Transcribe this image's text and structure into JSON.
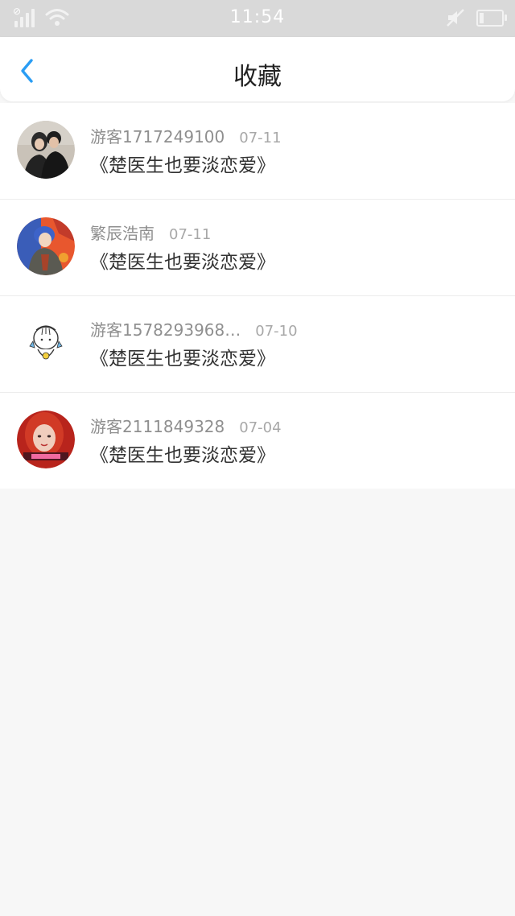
{
  "status_bar": {
    "time": "11:54"
  },
  "header": {
    "title": "收藏",
    "back_icon": "chevron-left-icon",
    "accent_color": "#2a9df4"
  },
  "favorites": [
    {
      "user": "游客1717249100",
      "date": "07-11",
      "book": "《楚医生也要淡恋爱》",
      "avatar": "couple-photo"
    },
    {
      "user": "繁辰浩南",
      "date": "07-11",
      "book": "《楚医生也要淡恋爱》",
      "avatar": "anime-character"
    },
    {
      "user": "游客1578293968…",
      "date": "07-10",
      "book": "《楚医生也要淡恋爱》",
      "avatar": "cartoon-girl-drawing"
    },
    {
      "user": "游客2111849328",
      "date": "07-04",
      "book": "《楚医生也要淡恋爱》",
      "avatar": "red-hair-girl"
    }
  ]
}
